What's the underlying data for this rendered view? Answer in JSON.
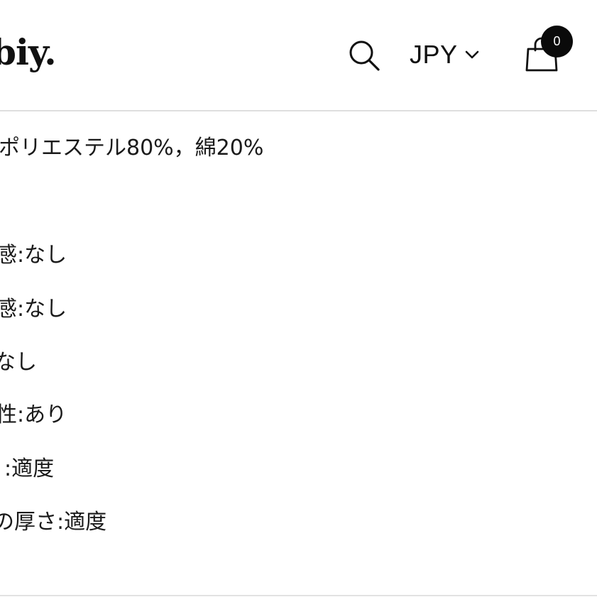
{
  "header": {
    "logo_text": "biy.",
    "currency": "JPY",
    "cart_count": "0",
    "icons": {
      "search": "search-icon",
      "currency_dropdown": "chevron-down-icon",
      "cart": "shopping-bag-icon"
    }
  },
  "content": {
    "lines": [
      "ポリエステル80%，綿20%",
      "感:なし",
      "感:なし",
      "なし",
      "性:あり",
      ":適度",
      "の厚さ:適度"
    ]
  },
  "colors": {
    "text": "#111111",
    "background": "#ffffff",
    "badge": "#0a0a0a",
    "divider": "#dedede"
  }
}
